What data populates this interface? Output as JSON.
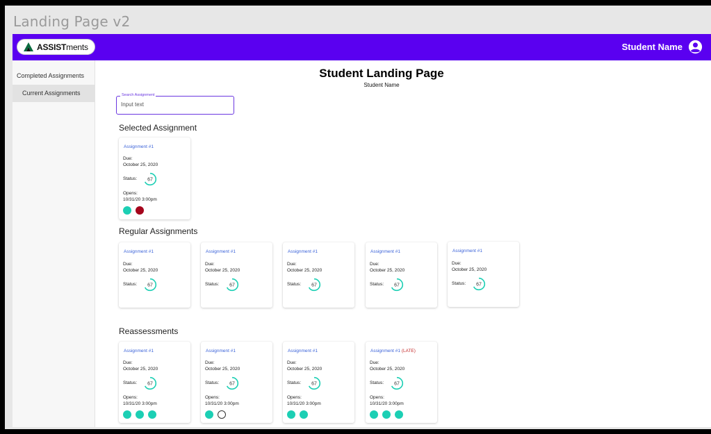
{
  "window": {
    "title": "Landing Page v2"
  },
  "header": {
    "logo_bold": "ASSIST",
    "logo_light": "ments",
    "user_name": "Student Name",
    "brand_color": "#5a00f0"
  },
  "sidebar": {
    "items": [
      {
        "label": "Completed Assignments"
      },
      {
        "label": "Current Assignments"
      }
    ]
  },
  "main": {
    "title": "Student Landing Page",
    "subtitle": "Student Name",
    "search": {
      "label": "Search Assignment",
      "value": "Input text"
    }
  },
  "labels": {
    "due": "Due:",
    "status": "Status:",
    "opens": "Opens:"
  },
  "sections": {
    "selected": {
      "title": "Selected Assignment",
      "card": {
        "title": "Assignment #1",
        "due": "October 25, 2020",
        "status": "67",
        "opens": "10/31/20 3:00pm",
        "dots": [
          "teal",
          "red"
        ]
      }
    },
    "regular": {
      "title": "Regular Assignments",
      "cards": [
        {
          "title": "Assignment #1",
          "due": "October 25, 2020",
          "status": "67"
        },
        {
          "title": "Assignment #1",
          "due": "October 25, 2020",
          "status": "67"
        },
        {
          "title": "Assignment #1",
          "due": "October 25, 2020",
          "status": "67"
        },
        {
          "title": "Assignment #1",
          "due": "October 25, 2020",
          "status": "67"
        },
        {
          "title": "Assignment #1",
          "due": "October 25, 2020",
          "status": "67"
        }
      ]
    },
    "reassessments": {
      "title": "Reassessments",
      "cards": [
        {
          "title": "Assignment #1",
          "late": "",
          "due": "October 25, 2020",
          "status": "67",
          "opens": "10/31/20 3:00pm",
          "dots": [
            "teal",
            "teal",
            "teal"
          ]
        },
        {
          "title": "Assignment #1",
          "late": "",
          "due": "October 25, 2020",
          "status": "67",
          "opens": "10/31/20 3:00pm",
          "dots": [
            "teal",
            "empty"
          ]
        },
        {
          "title": "Assignment #1",
          "late": "",
          "due": "October 25, 2020",
          "status": "67",
          "opens": "10/31/20 3:00pm",
          "dots": [
            "teal",
            "teal"
          ]
        },
        {
          "title": "Assignment #1",
          "late": "(LATE)",
          "due": "October 25, 2020",
          "status": "67",
          "opens": "10/31/20 3:00pm",
          "dots": [
            "teal",
            "teal",
            "teal"
          ]
        }
      ]
    }
  },
  "colors": {
    "teal": "#1ccfb4",
    "red": "#a5051c",
    "link": "#3a62d8",
    "late": "#c42a2a"
  }
}
